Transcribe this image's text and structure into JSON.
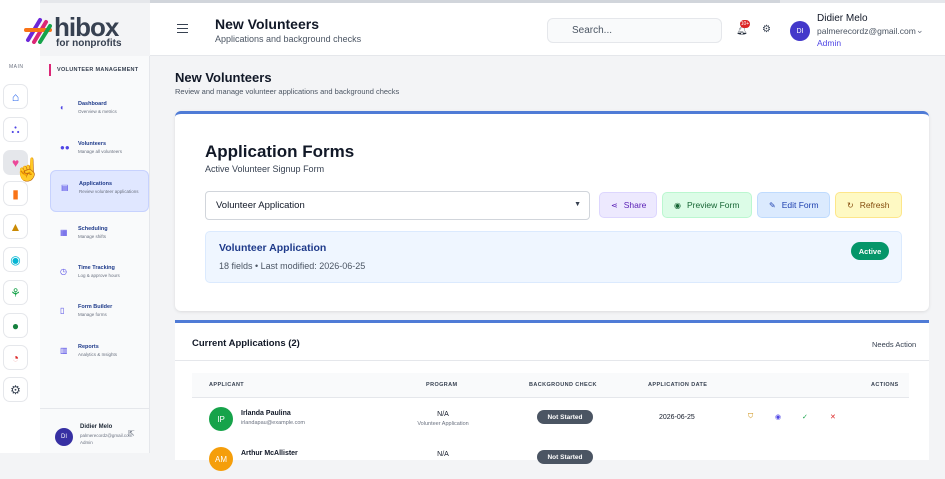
{
  "brand": {
    "name": "hibox",
    "tagline": "for nonprofits"
  },
  "rail": {
    "label": "MAIN",
    "items": [
      {
        "icon": "home-icon",
        "glyph": "⌂",
        "color": "#2563eb"
      },
      {
        "icon": "org-chart-icon",
        "glyph": "⛬",
        "color": "#4f46e5"
      },
      {
        "icon": "heart-icon",
        "glyph": "♥",
        "color": "#ec4899"
      },
      {
        "icon": "book-icon",
        "glyph": "▮",
        "color": "#f97316"
      },
      {
        "icon": "graduation-icon",
        "glyph": "▲",
        "color": "#ca8a04"
      },
      {
        "icon": "target-icon",
        "glyph": "◉",
        "color": "#06b6d4"
      },
      {
        "icon": "network-icon",
        "glyph": "⚘",
        "color": "#16a34a"
      },
      {
        "icon": "users-icon",
        "glyph": "●",
        "color": "#15803d"
      },
      {
        "icon": "pie-chart-icon",
        "glyph": "◔",
        "color": "#dc2626"
      },
      {
        "icon": "settings-icon",
        "glyph": "⚙",
        "color": "#374151"
      }
    ]
  },
  "menu": {
    "heading": "VOLUNTEER MANAGEMENT",
    "items": [
      {
        "label": "Dashboard",
        "sub": "Overview & metrics",
        "icon": "dashboard-icon",
        "glyph": "◐"
      },
      {
        "label": "Volunteers",
        "sub": "Manage all volunteers",
        "icon": "users-icon",
        "glyph": "●●"
      },
      {
        "label": "Applications",
        "sub": "Review volunteer applications",
        "icon": "clipboard-icon",
        "glyph": "▤"
      },
      {
        "label": "Scheduling",
        "sub": "Manage shifts",
        "icon": "calendar-icon",
        "glyph": "▦"
      },
      {
        "label": "Time Tracking",
        "sub": "Log & approve hours",
        "icon": "clock-icon",
        "glyph": "◷"
      },
      {
        "label": "Form Builder",
        "sub": "Manage forms",
        "icon": "form-icon",
        "glyph": "▯"
      },
      {
        "label": "Reports",
        "sub": "Analytics & Insights",
        "icon": "bar-chart-icon",
        "glyph": "▥"
      }
    ],
    "profile": {
      "initials": "DI",
      "name": "Didier Melo",
      "email": "palmerecordz@gmail.com",
      "role": "Admin"
    }
  },
  "header": {
    "title": "New Volunteers",
    "subtitle": "Applications and background checks",
    "search_placeholder": "Search...",
    "notif_count": "10+",
    "user": {
      "initials": "DI",
      "name": "Didier Melo",
      "email": "palmerecordz@gmail.com",
      "role": "Admin"
    }
  },
  "page": {
    "title": "New Volunteers",
    "subtitle": "Review and manage volunteer applications and background checks"
  },
  "forms": {
    "title": "Application Forms",
    "subtitle": "Active Volunteer Signup Form",
    "selected": "Volunteer Application",
    "buttons": {
      "share": "Share",
      "preview": "Preview Form",
      "edit": "Edit Form",
      "refresh": "Refresh"
    },
    "info": {
      "title": "Volunteer Application",
      "meta": "18 fields • Last modified: 2026-06-25",
      "status": "Active"
    }
  },
  "applications": {
    "title": "Current Applications (2)",
    "filter": "Needs Action",
    "columns": [
      "APPLICANT",
      "PROGRAM",
      "BACKGROUND CHECK",
      "APPLICATION DATE",
      "ACTIONS"
    ],
    "rows": [
      {
        "initials": "IP",
        "name": "Irlanda Paulina",
        "email": "irlandapau@example.com",
        "program": "N/A",
        "program_sub": "Volunteer Application",
        "check": "Not Started",
        "date": "2026-06-25"
      },
      {
        "initials": "AM",
        "name": "Arthur McAllister",
        "email": "",
        "program": "N/A",
        "program_sub": "",
        "check": "Not Started",
        "date": ""
      }
    ]
  }
}
